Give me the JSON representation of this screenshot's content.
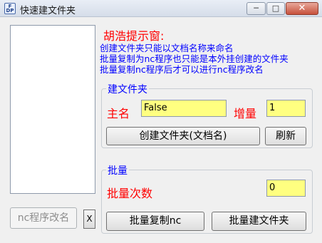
{
  "window": {
    "title": "快速建文件夹",
    "icon_text": "F DP",
    "controls": {
      "minimize": "─",
      "maximize": "□",
      "close": "✕"
    }
  },
  "left": {
    "rename_button": "nc程序改名",
    "close_button": "X"
  },
  "hint": {
    "title": "胡浩提示窗:",
    "lines": [
      "创建文件夹只能以文档名称来命名",
      "批量复制为nc程序也只能是本外挂创建的文件夹",
      "批量复制nc程序后才可以进行nc程序改名"
    ]
  },
  "create_group": {
    "title": "建文件夹",
    "name_label": "主名",
    "name_value": "False",
    "increment_label": "增量",
    "increment_value": "1",
    "create_button": "创建文件夹(文档名)",
    "refresh_button": "刷新"
  },
  "batch_group": {
    "title": "批量",
    "count_label": "批量次数",
    "count_value": "0",
    "copy_button": "批量复制nc",
    "create_button": "批量建文件夹"
  },
  "colors": {
    "hint_title": "#ff0000",
    "hint_text": "#0000ff",
    "input_bg": "#ffff80"
  }
}
